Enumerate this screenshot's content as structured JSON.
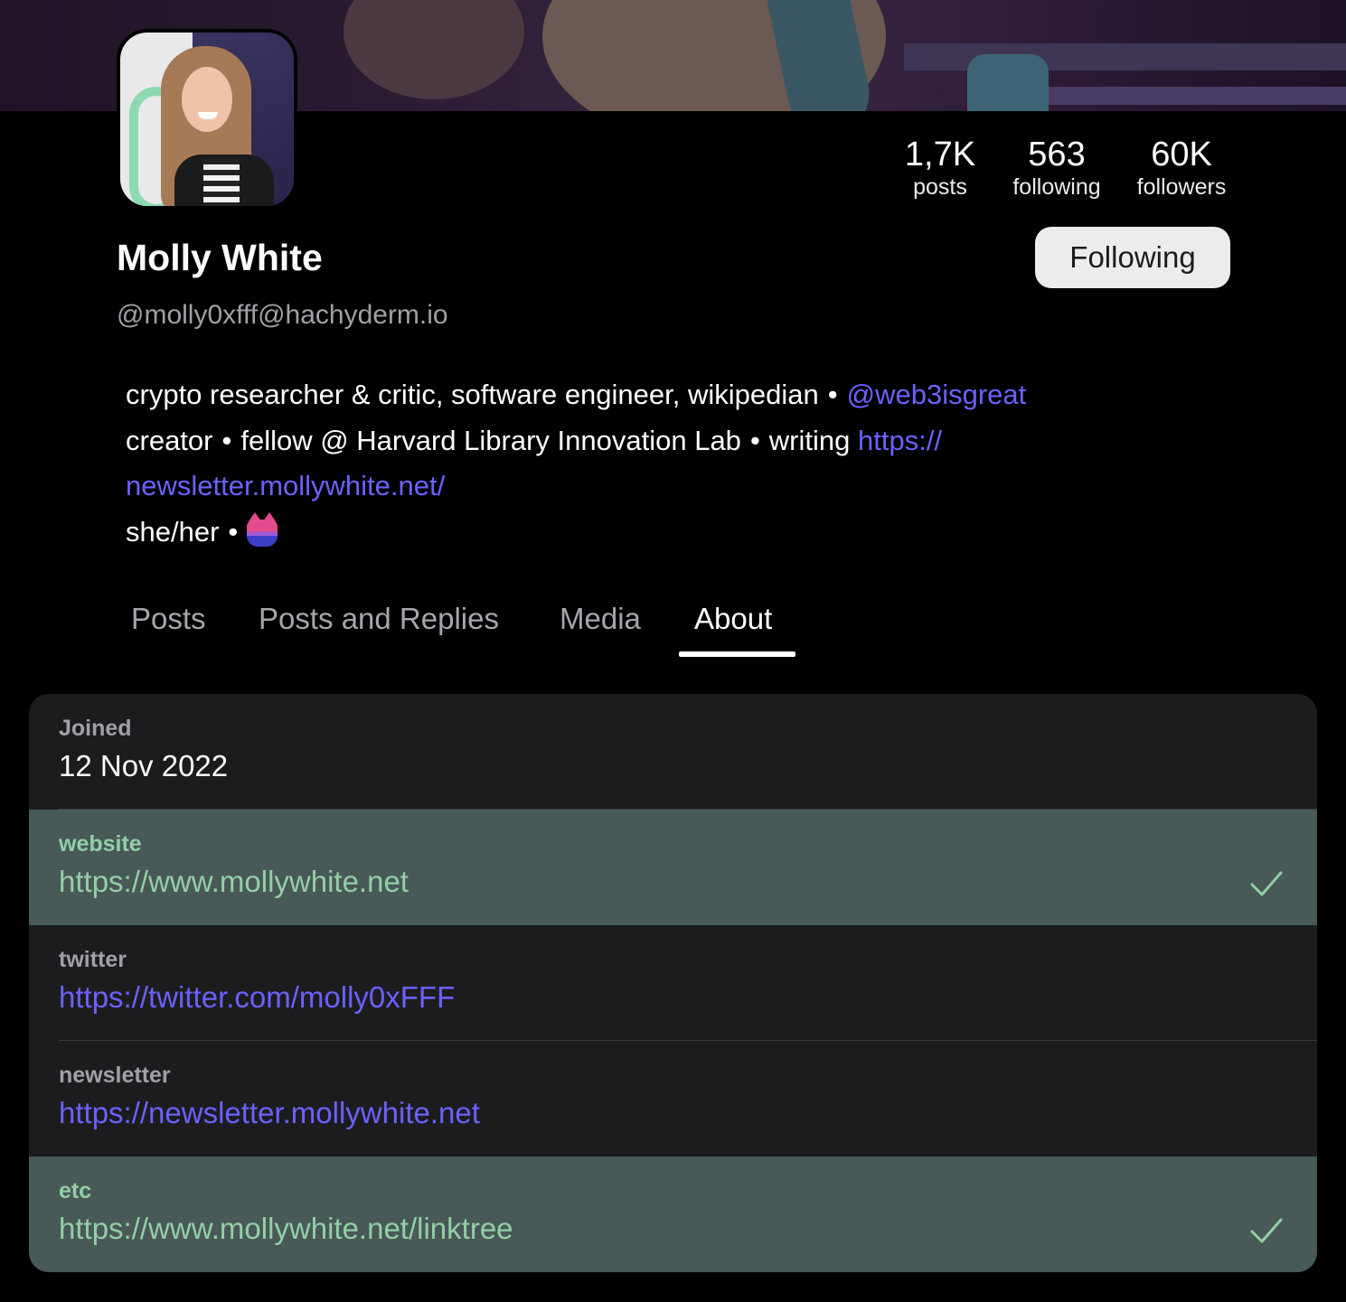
{
  "profile": {
    "name": "Molly White",
    "handle": "@molly0xfff@hachyderm.io",
    "follow_button": "Following",
    "stats": {
      "posts": {
        "value": "1,7K",
        "label": "posts"
      },
      "following": {
        "value": "563",
        "label": "following"
      },
      "followers": {
        "value": "60K",
        "label": "followers"
      }
    },
    "bio": {
      "line1_text": "crypto researcher & critic, software engineer, wikipedian",
      "line1_sep": "•",
      "mention": "@web3isgreat",
      "line2_creator": "creator",
      "line2_sep1": "•",
      "line2_fellow": "fellow @ Harvard Library Innovation Lab",
      "line2_sep2": "•",
      "line2_writing": "writing",
      "link_part1": "https://",
      "link_part2": "newsletter.mollywhite.net/",
      "line4_pronouns": "she/her",
      "line4_sep": "•",
      "emoji_icon": "bi-pride-cat-emoji"
    }
  },
  "tabs": [
    {
      "label": "Posts",
      "active": false
    },
    {
      "label": "Posts and Replies",
      "active": false
    },
    {
      "label": "Media",
      "active": false
    },
    {
      "label": "About",
      "active": true
    }
  ],
  "about": {
    "joined_label": "Joined",
    "joined_value": "12 Nov 2022",
    "fields": [
      {
        "label": "website",
        "value": "https://www.mollywhite.net",
        "verified": true
      },
      {
        "label": "twitter",
        "value": "https://twitter.com/molly0xFFF",
        "verified": false
      },
      {
        "label": "newsletter",
        "value": "https://newsletter.mollywhite.net",
        "verified": false
      },
      {
        "label": "etc",
        "value": "https://www.mollywhite.net/linktree",
        "verified": true
      }
    ]
  },
  "colors": {
    "background": "#000000",
    "link": "#6b62ff",
    "verified_bg": "#485957",
    "verified_text": "#93cfa6",
    "card_bg": "#1c1c1e"
  }
}
